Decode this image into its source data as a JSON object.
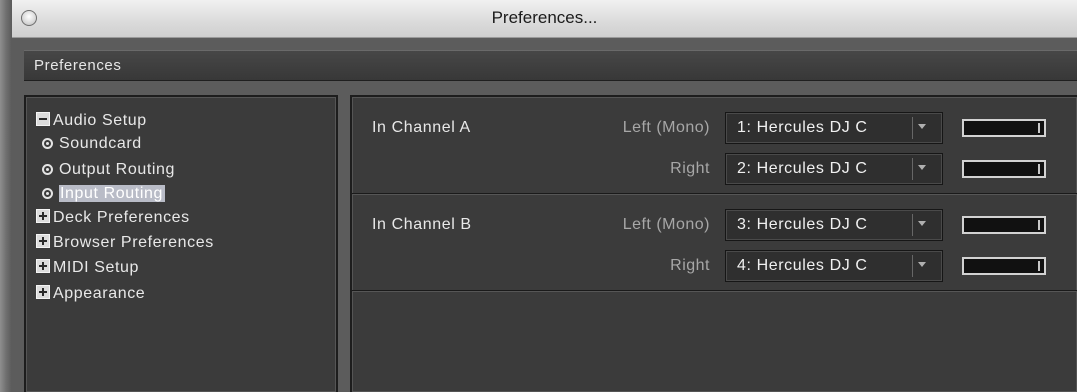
{
  "window": {
    "title": "Preferences..."
  },
  "section": {
    "title": "Preferences"
  },
  "tree": {
    "items": [
      {
        "label": "Audio Setup",
        "kind": "collapse",
        "icon": "minus-box-icon"
      },
      {
        "label": "Soundcard",
        "kind": "child",
        "icon": "radio-dot-icon"
      },
      {
        "label": "Output Routing",
        "kind": "child",
        "icon": "radio-dot-icon"
      },
      {
        "label": "Input Routing",
        "kind": "child",
        "icon": "radio-dot-icon",
        "selected": true
      },
      {
        "label": "Deck Preferences",
        "kind": "expand",
        "icon": "plus-box-icon"
      },
      {
        "label": "Browser Preferences",
        "kind": "expand",
        "icon": "plus-box-icon"
      },
      {
        "label": "MIDI Setup",
        "kind": "expand",
        "icon": "plus-box-icon"
      },
      {
        "label": "Appearance",
        "kind": "expand",
        "icon": "plus-box-icon"
      }
    ]
  },
  "routing": {
    "channels": [
      {
        "name": "In Channel A",
        "inputs": [
          {
            "side": "Left (Mono)",
            "value": "1: Hercules DJ C",
            "level": 0
          },
          {
            "side": "Right",
            "value": "2: Hercules DJ C",
            "level": 0
          }
        ]
      },
      {
        "name": "In Channel B",
        "inputs": [
          {
            "side": "Left (Mono)",
            "value": "3: Hercules DJ C",
            "level": 0
          },
          {
            "side": "Right",
            "value": "4: Hercules DJ C",
            "level": 0
          }
        ]
      }
    ]
  },
  "colors": {
    "background": "#5c5c5c",
    "panel": "#3b3b3b",
    "selection": "#b9bcc7"
  }
}
